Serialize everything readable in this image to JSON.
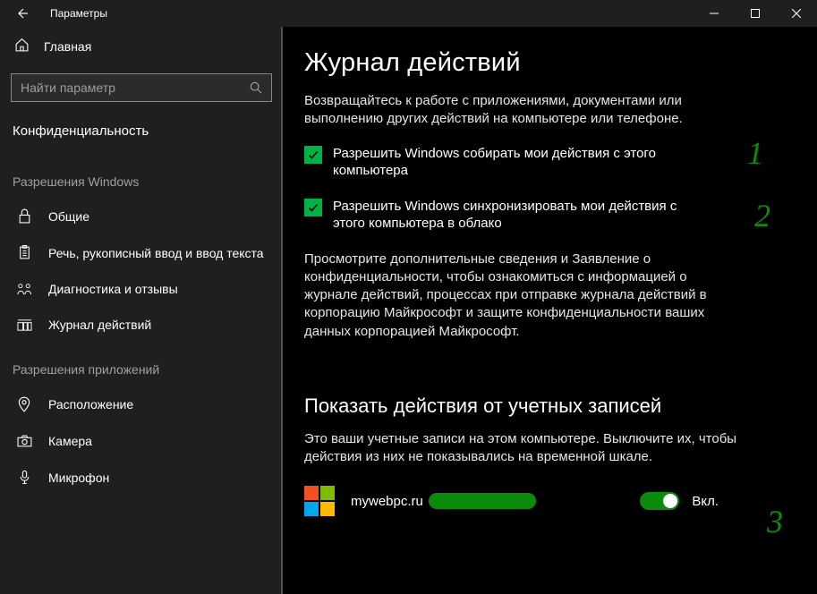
{
  "titlebar": {
    "title": "Параметры"
  },
  "sidebar": {
    "home": "Главная",
    "search_placeholder": "Найти параметр",
    "category": "Конфиденциальность",
    "group1": "Разрешения Windows",
    "items1": [
      {
        "label": "Общие"
      },
      {
        "label": "Речь, рукописный ввод и ввод текста"
      },
      {
        "label": "Диагностика и отзывы"
      },
      {
        "label": "Журнал действий"
      }
    ],
    "group2": "Разрешения приложений",
    "items2": [
      {
        "label": "Расположение"
      },
      {
        "label": "Камера"
      },
      {
        "label": "Микрофон"
      }
    ]
  },
  "main": {
    "title": "Журнал действий",
    "lead": "Возвращайтесь к работе с приложениями, документами или выполнению других действий на компьютере или телефоне.",
    "cb1": "Разрешить Windows собирать мои действия с этого компьютера",
    "cb2": "Разрешить Windows синхронизировать мои действия с этого компьютера в облако",
    "para": "Просмотрите дополнительные сведения и Заявление о конфиденциальности, чтобы ознакомиться с информацией о журнале действий, процессах при отправке журнала действий в корпорацию Майкрософт и защите конфиденциальности ваших данных корпорацией Майкрософт.",
    "section2": "Показать действия от учетных записей",
    "section2_desc": "Это ваши учетные записи на этом компьютере. Выключите их, чтобы действия из них не показывались на временной шкале.",
    "account_name": "mywebpc.ru",
    "toggle_label": "Вкл."
  },
  "annotations": {
    "a1": "1",
    "a2": "2",
    "a3": "3"
  }
}
